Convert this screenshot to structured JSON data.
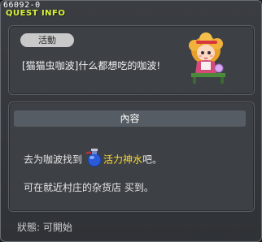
{
  "window": {
    "quest_id": "66092-0",
    "title": "QUEST INFO"
  },
  "activity": {
    "badge": "活動",
    "text": "[猫猫虫咖波]什么都想吃的咖波!"
  },
  "content": {
    "header": "內容",
    "line1_prefix": "去为咖波找到",
    "item_icon": "blue-potion-icon",
    "item_name": "活力神水",
    "line1_suffix": "吧。",
    "line2": "可在就近村庄的杂货店 买到。"
  },
  "status": {
    "label": "狀態:",
    "value": "可開始"
  },
  "colors": {
    "title": "#d9f23a",
    "item_highlight": "#ffd830",
    "panel_bg": "#3d4146"
  }
}
